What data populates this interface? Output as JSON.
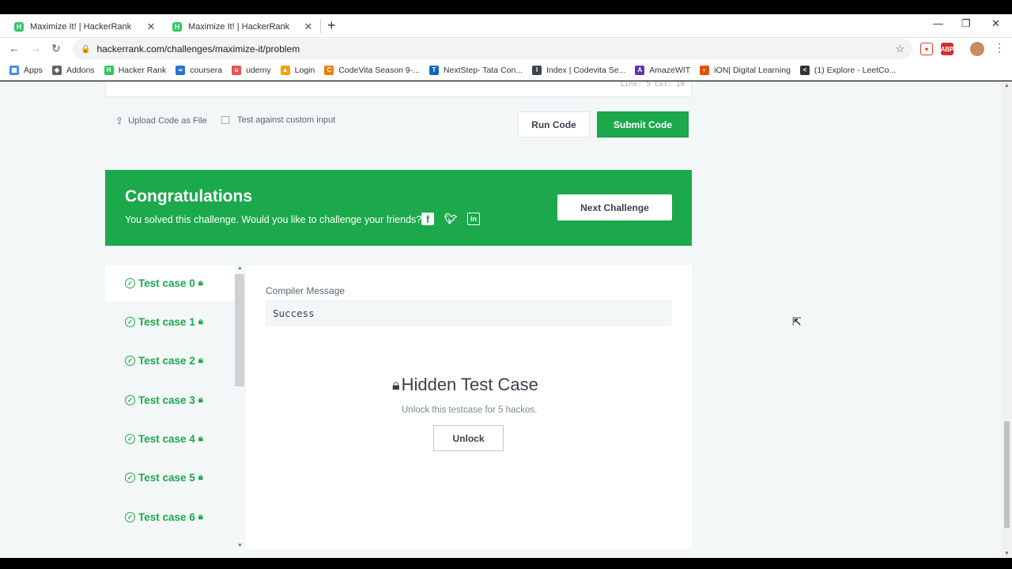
{
  "browser": {
    "tabs": [
      {
        "title": "Maximize It! | HackerRank",
        "favicon": "H"
      },
      {
        "title": "Maximize It! | HackerRank",
        "favicon": "H"
      }
    ],
    "url": "hackerrank.com/challenges/maximize-it/problem",
    "bookmarks": [
      {
        "label": "Apps",
        "icon": "apps-grid-icon",
        "color": "#4285f4"
      },
      {
        "label": "Addons",
        "icon": "addons-icon",
        "color": "#5f6368"
      },
      {
        "label": "Hacker Rank",
        "icon": "hackerrank-icon",
        "color": "#2ec866"
      },
      {
        "label": "coursera",
        "icon": "coursera-icon",
        "color": "#2a73cc"
      },
      {
        "label": "udemy",
        "icon": "udemy-icon",
        "color": "#ec5252"
      },
      {
        "label": "Login",
        "icon": "login-icon",
        "color": "#f0a30a"
      },
      {
        "label": "CodeVita Season 9-...",
        "icon": "codevita-icon",
        "color": "#f57c00"
      },
      {
        "label": "NextStep- Tata Con...",
        "icon": "tata-icon",
        "color": "#1565c0"
      },
      {
        "label": "Index | Codevita Se...",
        "icon": "index-icon",
        "color": "#37474f"
      },
      {
        "label": "AmazeWIT",
        "icon": "amazewit-icon",
        "color": "#5e35b1"
      },
      {
        "label": "iON| Digital Learning",
        "icon": "ion-icon",
        "color": "#e65100"
      },
      {
        "label": "(1) Explore - LeetCo...",
        "icon": "leetcode-icon",
        "color": "#333333"
      }
    ],
    "extensions": [
      {
        "label": "",
        "color": "#e53935"
      },
      {
        "label": "ABP",
        "color": "#d32f2f"
      }
    ]
  },
  "editor": {
    "cursor_pos": "Line: 5 Col: 10"
  },
  "actions": {
    "upload_label": "Upload Code as File",
    "custom_input_label": "Test against custom input",
    "run_label": "Run Code",
    "submit_label": "Submit Code"
  },
  "banner": {
    "title": "Congratulations",
    "subtitle": "You solved this challenge. Would you like to challenge your friends?",
    "next_label": "Next Challenge"
  },
  "test_cases": [
    {
      "label": "Test case 0"
    },
    {
      "label": "Test case 1"
    },
    {
      "label": "Test case 2"
    },
    {
      "label": "Test case 3"
    },
    {
      "label": "Test case 4"
    },
    {
      "label": "Test case 5"
    },
    {
      "label": "Test case 6"
    }
  ],
  "result": {
    "compiler_label": "Compiler Message",
    "compiler_message": "Success",
    "hidden_title": "Hidden Test Case",
    "hidden_sub": "Unlock this testcase for 5 hackos.",
    "unlock_label": "Unlock"
  },
  "colors": {
    "accent_green": "#1ba94c",
    "text_dark": "#39424e",
    "page_bg": "#f3f7f7"
  }
}
